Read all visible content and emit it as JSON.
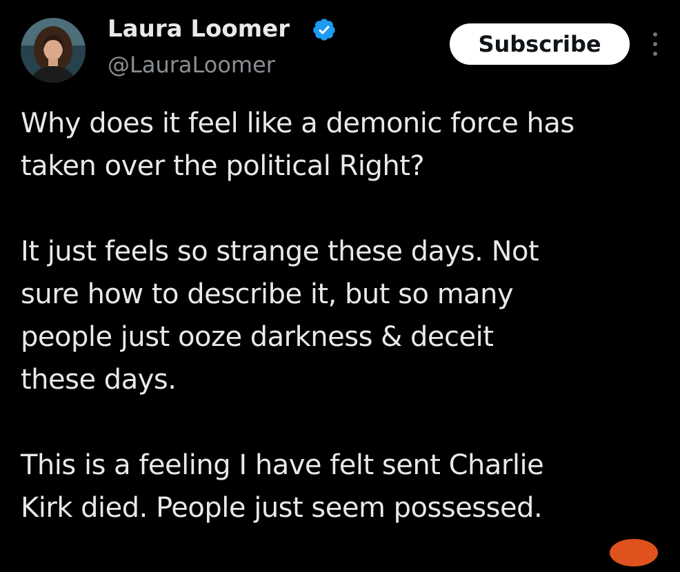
{
  "author": {
    "name": "Laura Loomer",
    "handle": "@LauraLoomer",
    "verified": true,
    "avatar_icon": "profile-photo"
  },
  "actions": {
    "subscribe_label": "Subscribe",
    "more_icon": "more-vertical-icon"
  },
  "post": {
    "paragraphs": [
      {
        "lines": [
          "Why does it feel like a demonic force has",
          "taken over the political Right?"
        ]
      },
      {
        "lines": [
          "It just feels so strange these days. Not",
          "sure how to describe it, but so many",
          "people just ooze darkness & deceit",
          "these days."
        ]
      },
      {
        "lines": [
          "This is a feeling I have felt sent Charlie",
          "Kirk died. People just seem possessed."
        ]
      }
    ]
  },
  "colors": {
    "background": "#000000",
    "text": "#e7e9ea",
    "secondary_text": "#8b8f93",
    "verified_blue": "#1d9bf0",
    "button_bg": "#ffffff",
    "button_text": "#0f1419"
  }
}
